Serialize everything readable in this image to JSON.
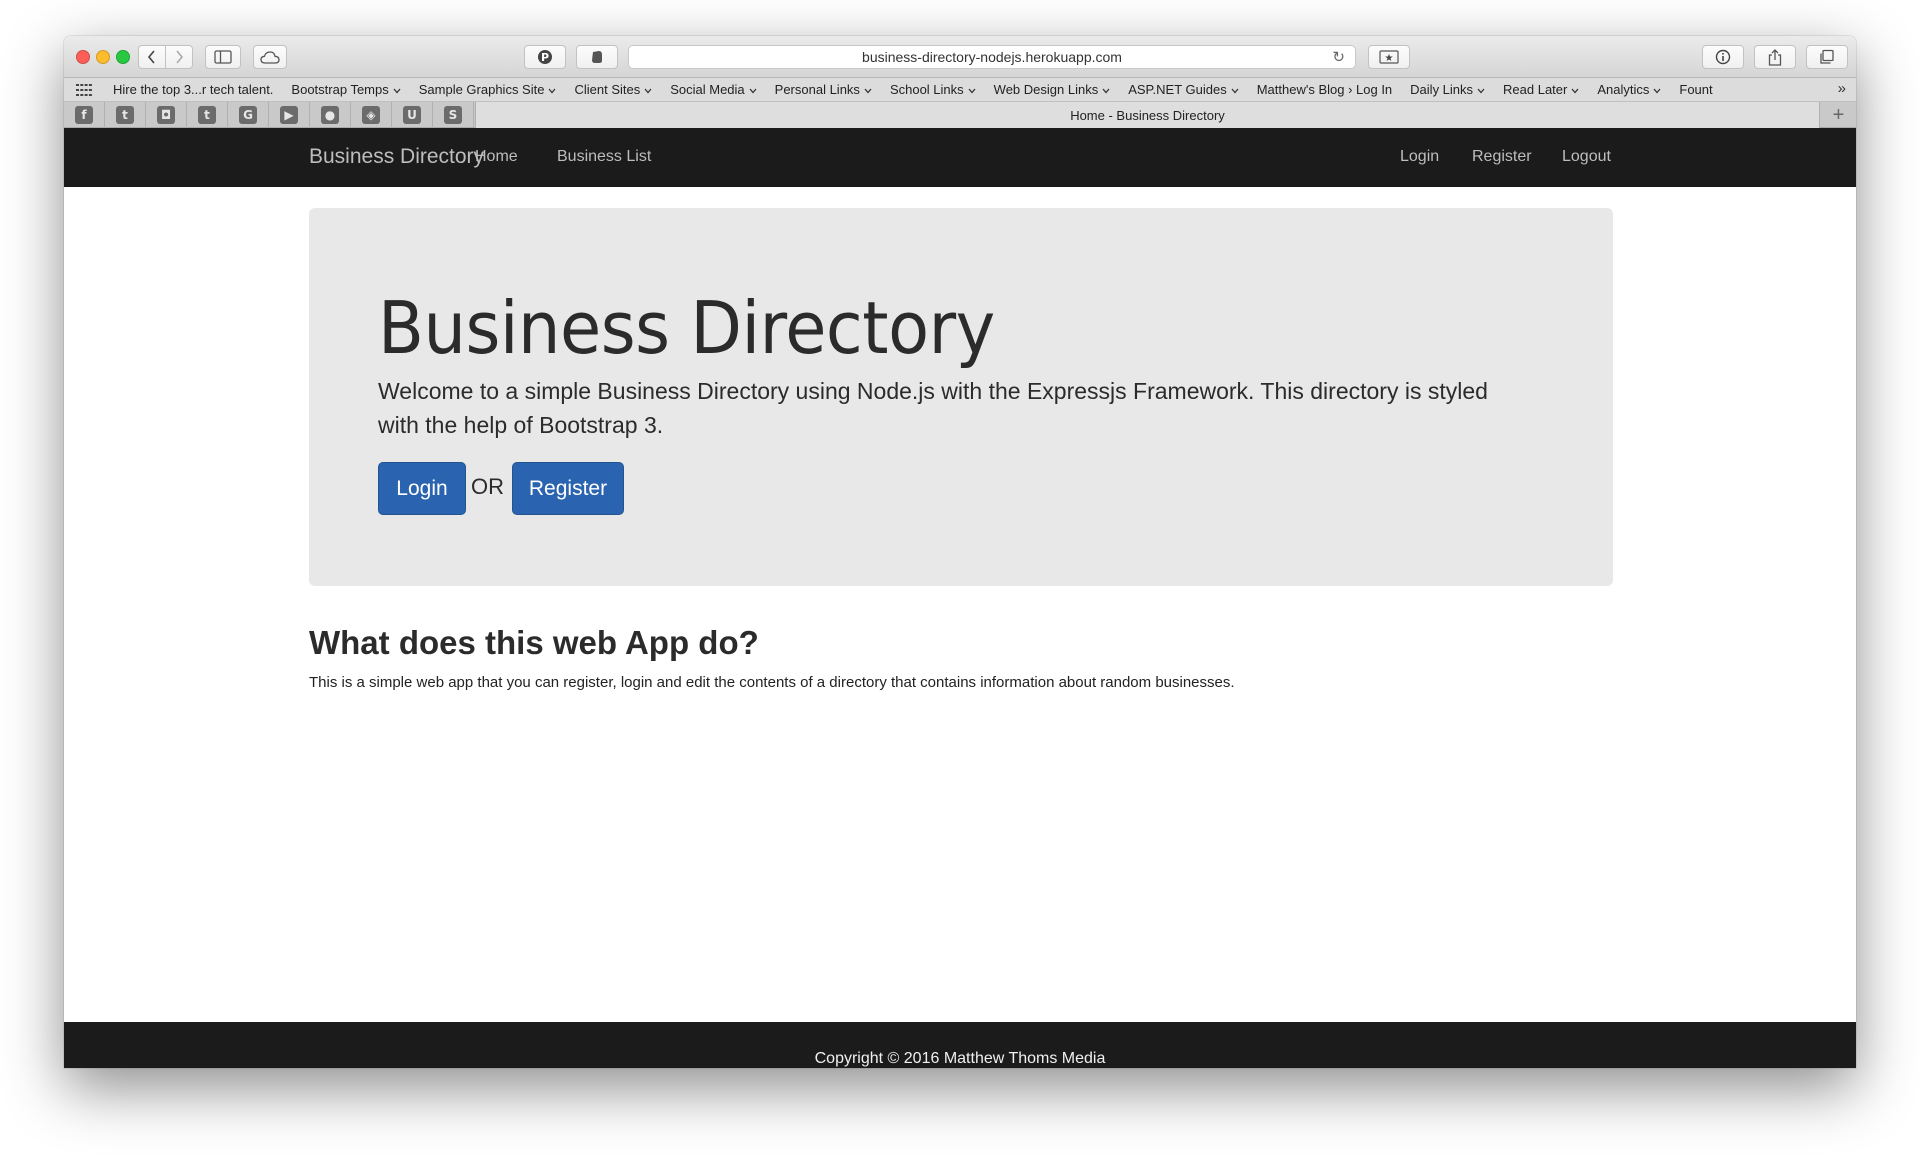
{
  "browser": {
    "url": "business-directory-nodejs.herokuapp.com",
    "favorites": [
      {
        "label": "Hire the top 3...r tech talent.",
        "dropdown": false
      },
      {
        "label": "Bootstrap Temps",
        "dropdown": true
      },
      {
        "label": "Sample Graphics Site",
        "dropdown": true
      },
      {
        "label": "Client Sites",
        "dropdown": true
      },
      {
        "label": "Social Media",
        "dropdown": true
      },
      {
        "label": "Personal Links",
        "dropdown": true
      },
      {
        "label": "School Links",
        "dropdown": true
      },
      {
        "label": "Web Design Links",
        "dropdown": true
      },
      {
        "label": "ASP.NET Guides",
        "dropdown": true
      },
      {
        "label": "Matthew's Blog › Log In",
        "dropdown": false
      },
      {
        "label": "Daily Links",
        "dropdown": true
      },
      {
        "label": "Read Later",
        "dropdown": true
      },
      {
        "label": "Analytics",
        "dropdown": true
      },
      {
        "label": "Fount",
        "dropdown": false
      }
    ],
    "more_glyph": "»",
    "pinned_tabs": [
      {
        "icon": "facebook-icon",
        "glyph": "f"
      },
      {
        "icon": "twitter-icon",
        "glyph": "t"
      },
      {
        "icon": "instagram-icon",
        "glyph": "◘"
      },
      {
        "icon": "tumblr-icon",
        "glyph": "t"
      },
      {
        "icon": "google-icon",
        "glyph": "G"
      },
      {
        "icon": "youtube-icon",
        "glyph": "▶"
      },
      {
        "icon": "github-icon",
        "glyph": "●"
      },
      {
        "icon": "codepen-icon",
        "glyph": "◈"
      },
      {
        "icon": "udemy-icon",
        "glyph": "U"
      },
      {
        "icon": "slack-icon",
        "glyph": "S"
      }
    ],
    "active_tab_title": "Home - Business Directory",
    "new_tab_glyph": "+"
  },
  "navbar": {
    "brand": "Business Directory",
    "home": "Home",
    "business_list": "Business List",
    "login": "Login",
    "register": "Register",
    "logout": "Logout"
  },
  "jumbotron": {
    "title": "Business Directory",
    "lead": "Welcome to a simple Business Directory using Node.js with the Expressjs Framework. This directory is styled with the help of Bootstrap 3.",
    "login_button": "Login",
    "or_text": "OR",
    "register_button": "Register"
  },
  "section": {
    "title": "What does this web App do?",
    "text": "This is a simple web app that you can register, login and edit the contents of a directory that contains information about random businesses."
  },
  "footer": {
    "copyright": "Copyright © 2016 Matthew Thoms Media"
  },
  "colors": {
    "navbar_bg": "#1b1b1b",
    "jumbotron_bg": "#e8e8e8",
    "primary_button": "#2a64b0",
    "close_light": "#fc5f57",
    "minimize_light": "#fdbc2e",
    "zoom_light": "#28c840"
  }
}
